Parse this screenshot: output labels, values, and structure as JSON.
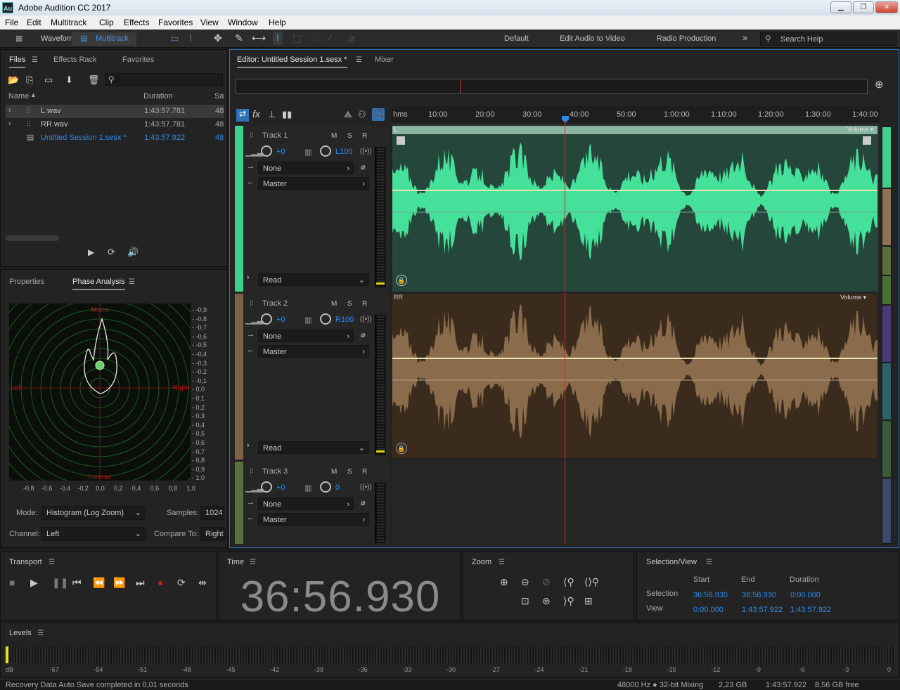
{
  "window": {
    "title": "Adobe Audition CC 2017",
    "app_icon": "Au"
  },
  "menu": [
    "File",
    "Edit",
    "Multitrack",
    "Clip",
    "Effects",
    "Favorites",
    "View",
    "Window",
    "Help"
  ],
  "toolbar": {
    "waveform_label": "Waveform",
    "multitrack_label": "Multitrack",
    "workspaces": [
      "Default",
      "Edit Audio to Video",
      "Radio Production"
    ],
    "more": "»",
    "search_placeholder": "Search Help"
  },
  "files_panel": {
    "tabs": [
      "Files",
      "Effects Rack",
      "Favorites"
    ],
    "columns": [
      "Name",
      "Duration",
      "Sa"
    ],
    "rows": [
      {
        "name": "L.wav",
        "duration": "1:43:57.781",
        "sample": "48"
      },
      {
        "name": "RR.wav",
        "duration": "1:43:57.781",
        "sample": "48"
      },
      {
        "name": "Untitled Session 1.sesx *",
        "duration": "1:43:57.922",
        "sample": "48"
      }
    ]
  },
  "analysis_panel": {
    "tabs": [
      "Properties",
      "Phase Analysis"
    ],
    "labels": {
      "mono": "Mono",
      "left": "Left",
      "right": "Right",
      "inverse": "Inverse"
    },
    "y_ticks": [
      "-0,9",
      "-0,8",
      "-0,7",
      "-0,6",
      "-0,5",
      "-0,4",
      "-0,3",
      "-0,2",
      "-0,1",
      "0,0",
      "0,1",
      "0,2",
      "0,3",
      "0,4",
      "0,5",
      "0,6",
      "0,7",
      "0,8",
      "0,9",
      "1,0"
    ],
    "x_ticks": [
      "-0,8",
      "-0,6",
      "-0,4",
      "-0,2",
      "0,0",
      "0,2",
      "0,4",
      "0,6",
      "0,8",
      "1,0"
    ],
    "mode_label": "Mode:",
    "mode_value": "Histogram (Log Zoom)",
    "samples_label": "Samples:",
    "samples_value": "1024",
    "channel_label": "Channel:",
    "channel_value": "Left",
    "compare_label": "Compare To:",
    "compare_value": "Right"
  },
  "editor": {
    "tabs": [
      "Editor: Untitled Session 1.sesx *",
      "Mixer"
    ],
    "ruler": [
      "hms",
      "10:00",
      "20:00",
      "30:00",
      "40:00",
      "50:00",
      "1:00:00",
      "1:10:00",
      "1:20:00",
      "1:30:00",
      "1:40:00"
    ],
    "tracks": [
      {
        "name": "Track 1",
        "volume": "+0",
        "pan": "L100",
        "input": "None",
        "output": "Master",
        "mode": "Read",
        "clip_label": "L",
        "color": "#3fd08e"
      },
      {
        "name": "Track 2",
        "volume": "+0",
        "pan": "R100",
        "input": "None",
        "output": "Master",
        "mode": "Read",
        "clip_label": "RR",
        "color": "#7d6346"
      },
      {
        "name": "Track 3",
        "volume": "+0",
        "pan": "0",
        "input": "None",
        "output": "Master"
      }
    ],
    "msr": [
      "M",
      "S",
      "R"
    ],
    "volume_label": "Volume"
  },
  "transport": {
    "title": "Transport"
  },
  "time": {
    "title": "Time",
    "value": "36:56.930"
  },
  "zoom": {
    "title": "Zoom"
  },
  "selection": {
    "title": "Selection/View",
    "cols": [
      "Start",
      "End",
      "Duration"
    ],
    "rows": [
      {
        "label": "Selection",
        "start": "36:56.930",
        "end": "36:56.930",
        "duration": "0:00.000"
      },
      {
        "label": "View",
        "start": "0:00.000",
        "end": "1:43:57.922",
        "duration": "1:43:57.922"
      }
    ]
  },
  "levels": {
    "title": "Levels",
    "scale": [
      "dB",
      "-57",
      "-54",
      "-51",
      "-48",
      "-45",
      "-42",
      "-39",
      "-36",
      "-33",
      "-30",
      "-27",
      "-24",
      "-21",
      "-18",
      "-15",
      "-12",
      "-9",
      "-6",
      "-3",
      "0"
    ]
  },
  "status": {
    "left": "Recovery Data Auto Save completed in 0,01 seconds",
    "items": [
      "48000 Hz ● 32-bit Mixing",
      "2,23 GB",
      "1:43:57.922",
      "8,56 GB free"
    ]
  }
}
